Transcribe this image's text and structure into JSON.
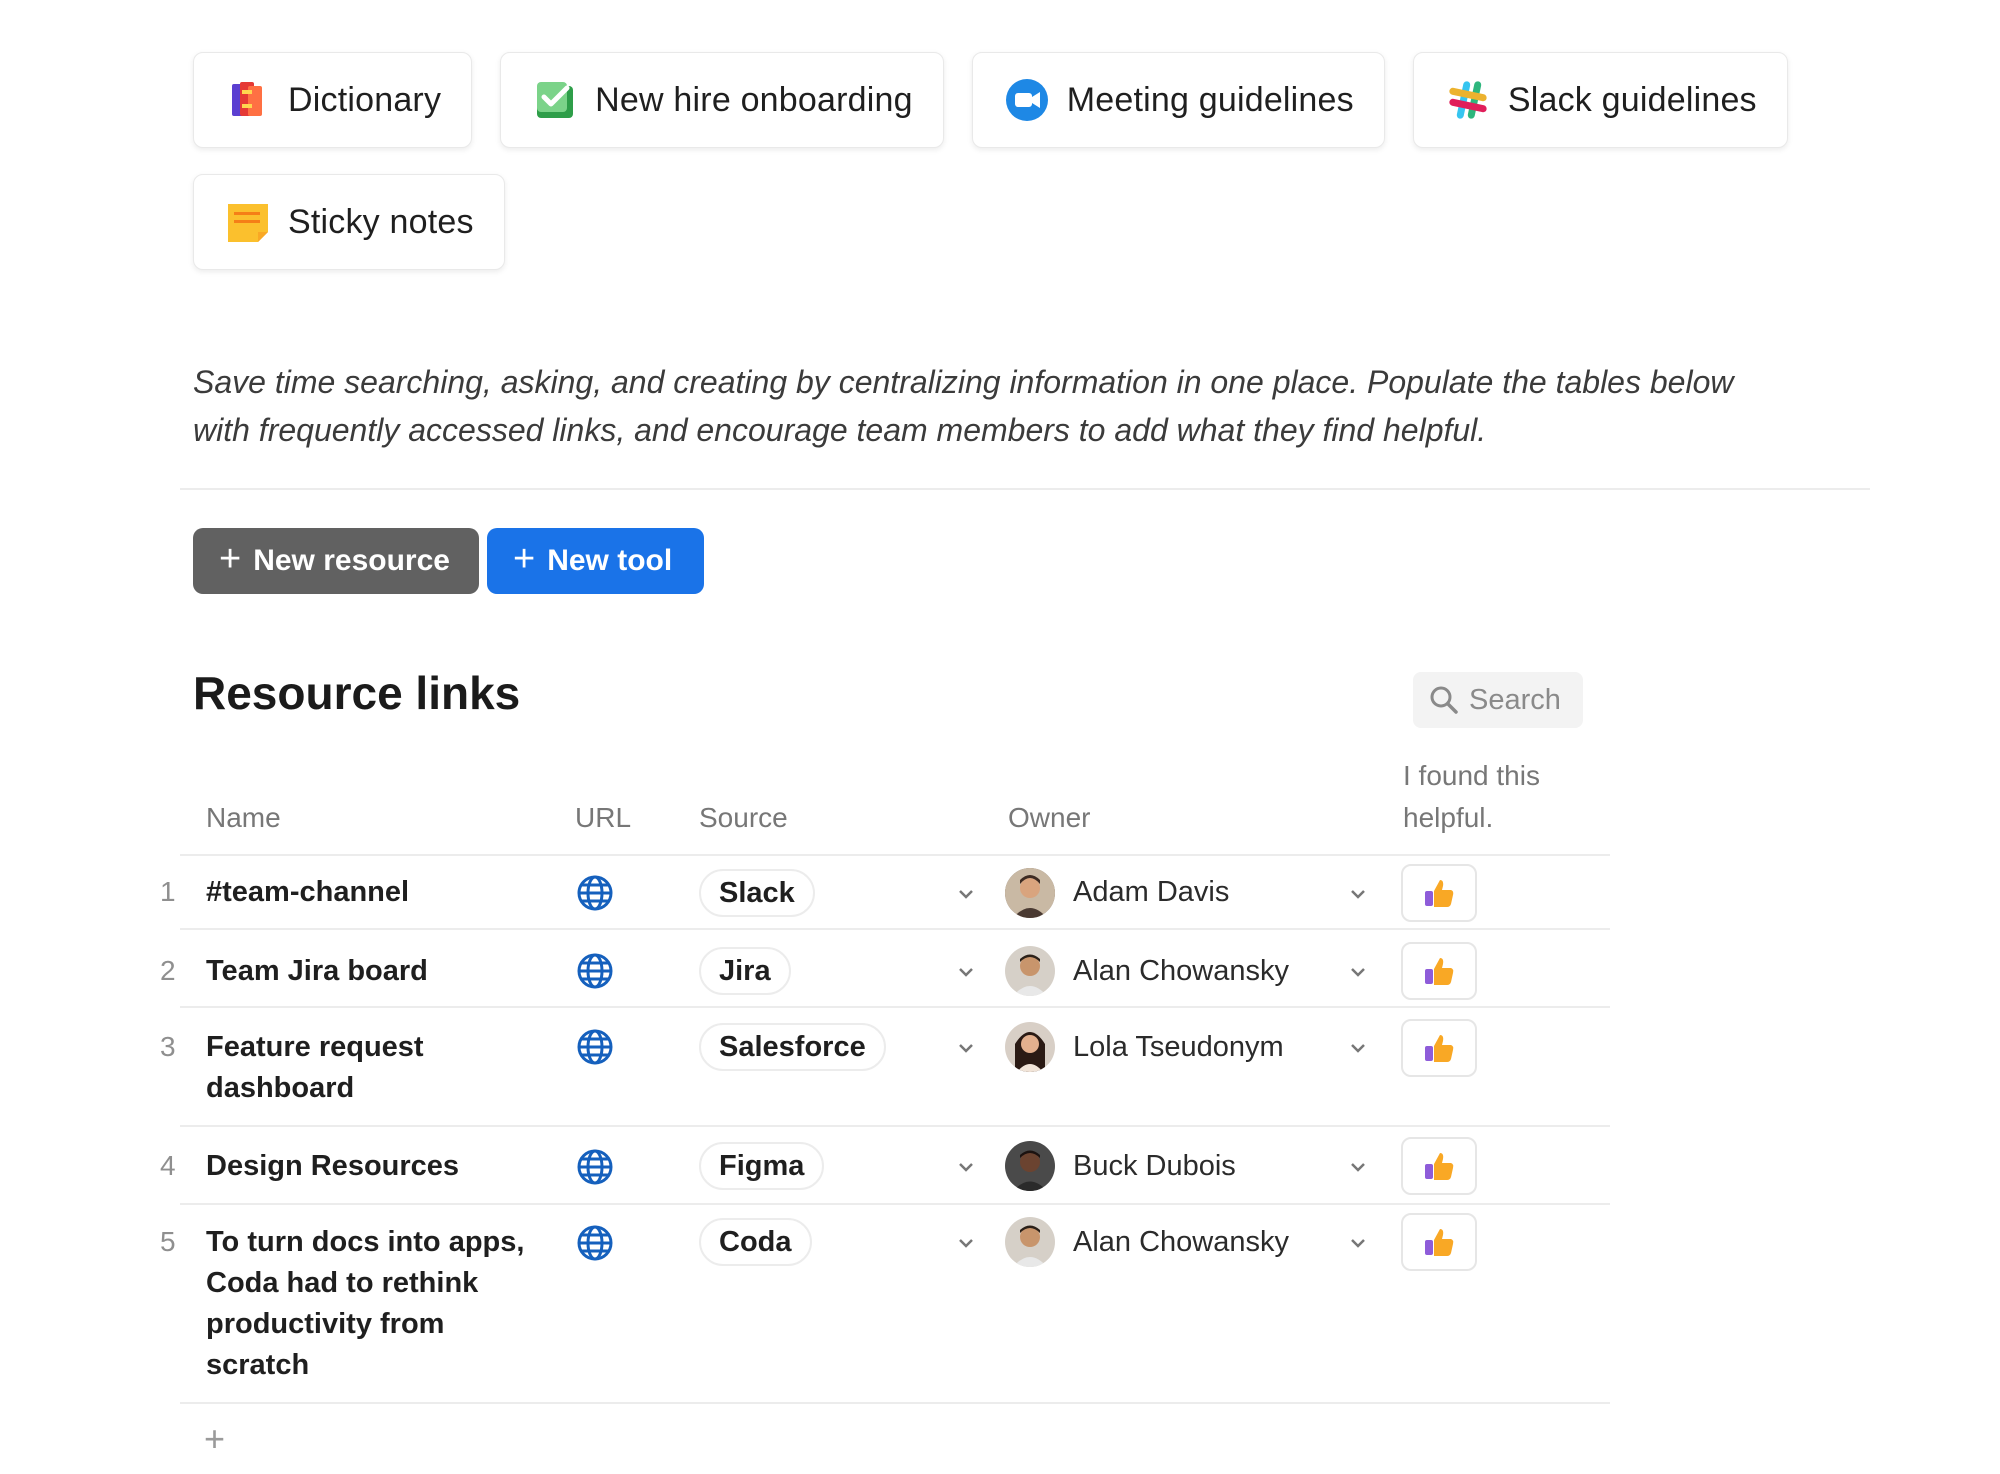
{
  "cards": [
    {
      "label": "Dictionary",
      "icon": "book-stack-icon"
    },
    {
      "label": "New hire onboarding",
      "icon": "checkmark-clipboard-icon"
    },
    {
      "label": "Meeting guidelines",
      "icon": "video-camera-icon"
    },
    {
      "label": "Slack guidelines",
      "icon": "slack-logo-icon"
    },
    {
      "label": "Sticky notes",
      "icon": "sticky-note-icon"
    }
  ],
  "description": "Save time searching, asking, and creating by centralizing information in one place. Populate the tables below with frequently accessed links, and encourage team members to add what they find helpful.",
  "buttons": {
    "new_resource": "New resource",
    "new_tool": "New tool"
  },
  "section": {
    "title": "Resource links",
    "search_placeholder": "Search"
  },
  "table": {
    "columns": {
      "name": "Name",
      "url": "URL",
      "source": "Source",
      "owner": "Owner",
      "helpful": "I found this helpful."
    },
    "rows": [
      {
        "num": "1",
        "name": "#team-channel",
        "source": "Slack",
        "owner": "Adam Davis"
      },
      {
        "num": "2",
        "name": "Team Jira board",
        "source": "Jira",
        "owner": "Alan Chowansky"
      },
      {
        "num": "3",
        "name": "Feature request dashboard",
        "source": "Salesforce",
        "owner": "Lola Tseudonym"
      },
      {
        "num": "4",
        "name": "Design Resources",
        "source": "Figma",
        "owner": "Buck Dubois"
      },
      {
        "num": "5",
        "name": "To turn docs into apps, Coda had to rethink productivity from scratch",
        "source": "Coda",
        "owner": "Alan Chowansky"
      }
    ],
    "add_row_symbol": "+"
  },
  "colors": {
    "primary_blue": "#1a73e8",
    "secondary_gray": "#616161",
    "globe_blue": "#1560bd"
  }
}
